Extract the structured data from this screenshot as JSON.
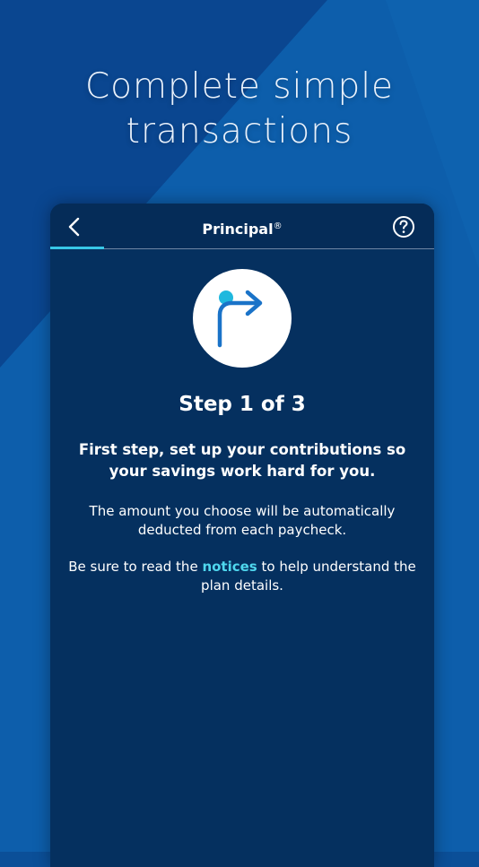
{
  "promo": {
    "title_line1": "Complete simple",
    "title_line2": "transactions"
  },
  "header": {
    "title": "Principal",
    "title_mark": "®",
    "back_icon": "chevron-left-icon",
    "help_icon": "question-circle-icon"
  },
  "step": {
    "icon": "turn-right-arrow-icon",
    "heading": "Step 1 of 3",
    "subheading": "First step, set up your contributions so your savings work hard for you.",
    "body": "The amount you choose will be automatically deducted from each paycheck.",
    "notice_prefix": "Be sure to read the ",
    "notice_link": "notices",
    "notice_suffix": " to help understand the plan details."
  },
  "colors": {
    "background": "#0b4f98",
    "panel": "#05305f",
    "accent": "#38c7e6",
    "link": "#4fd7ee",
    "icon_blue": "#1a73c8"
  }
}
